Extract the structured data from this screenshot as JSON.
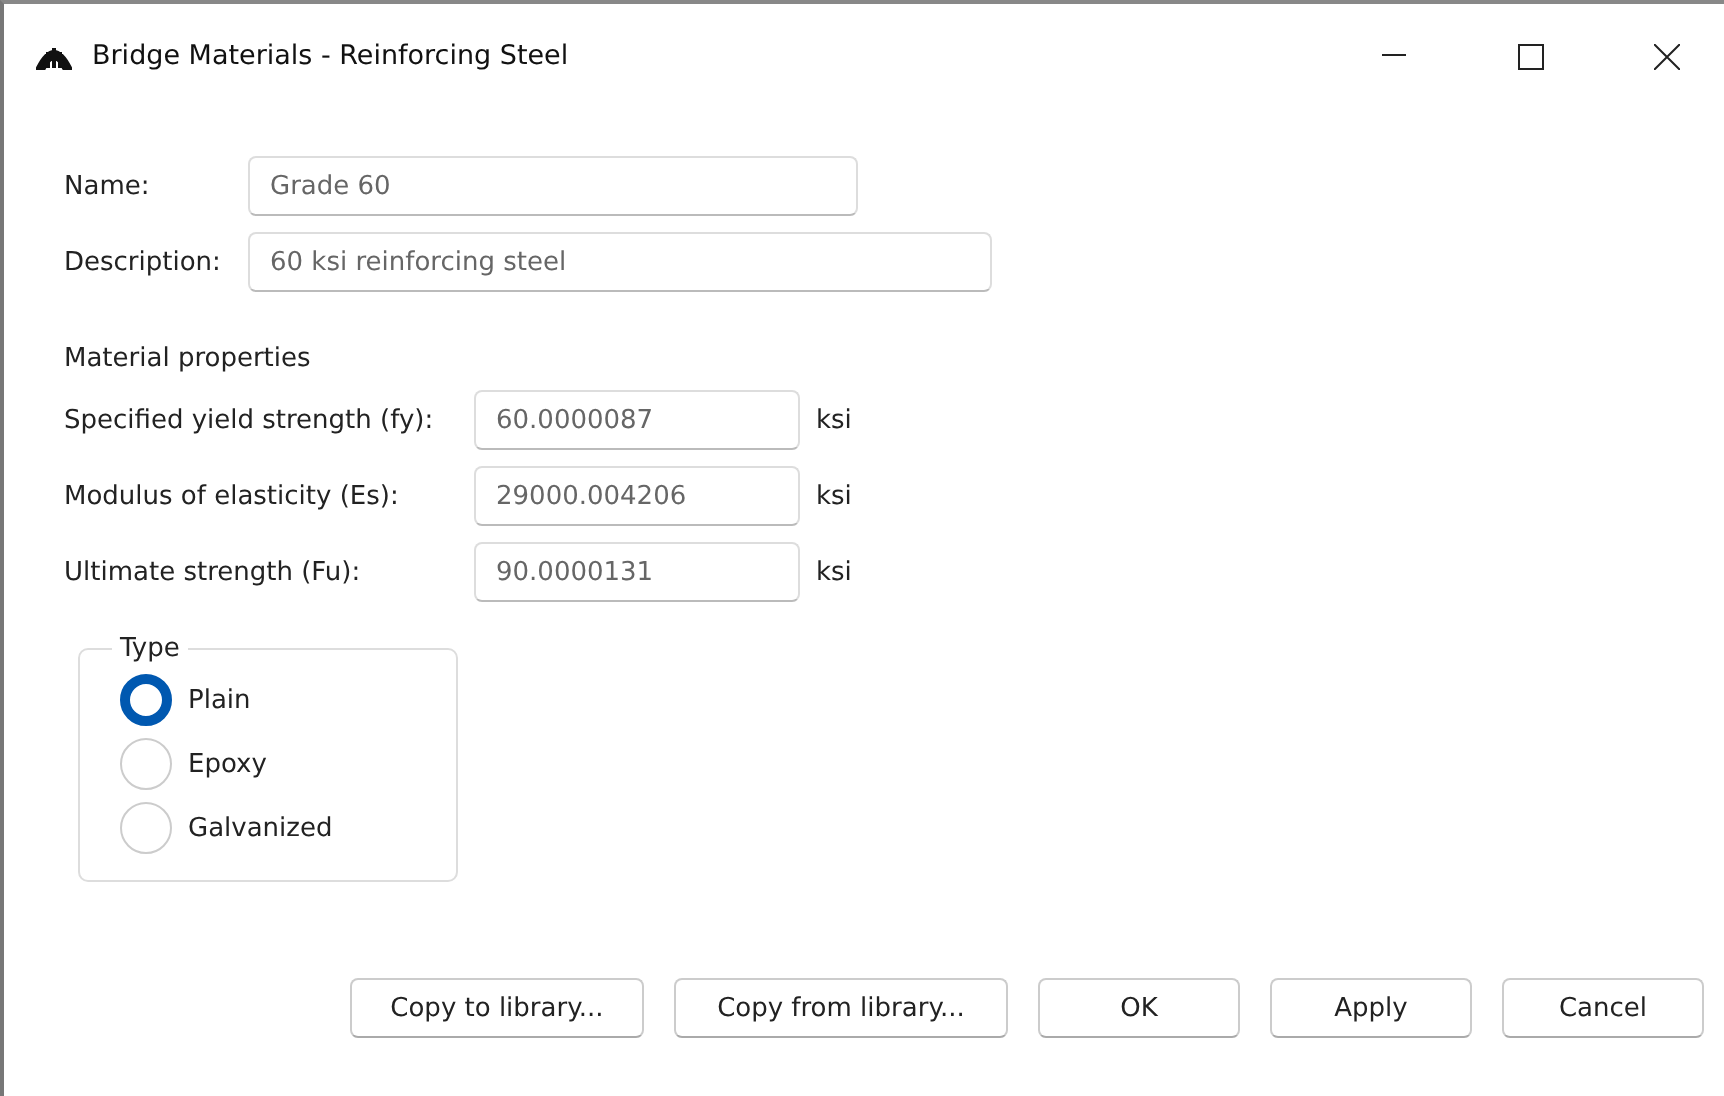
{
  "window": {
    "title": "Bridge Materials - Reinforcing Steel"
  },
  "name": {
    "label": "Name:",
    "value": "Grade 60"
  },
  "description": {
    "label": "Description:",
    "value": "60 ksi reinforcing steel"
  },
  "material_properties": {
    "heading": "Material properties",
    "rows": [
      {
        "label": "Specified yield strength (fy):",
        "value": "60.0000087",
        "unit": "ksi"
      },
      {
        "label": "Modulus of elasticity (Es):",
        "value": "29000.004206",
        "unit": "ksi"
      },
      {
        "label": "Ultimate strength (Fu):",
        "value": "90.0000131",
        "unit": "ksi"
      }
    ]
  },
  "type": {
    "legend": "Type",
    "options": [
      {
        "label": "Plain",
        "selected": true
      },
      {
        "label": "Epoxy",
        "selected": false
      },
      {
        "label": "Galvanized",
        "selected": false
      }
    ]
  },
  "buttons": [
    "Copy to library...",
    "Copy from library...",
    "OK",
    "Apply",
    "Cancel"
  ]
}
